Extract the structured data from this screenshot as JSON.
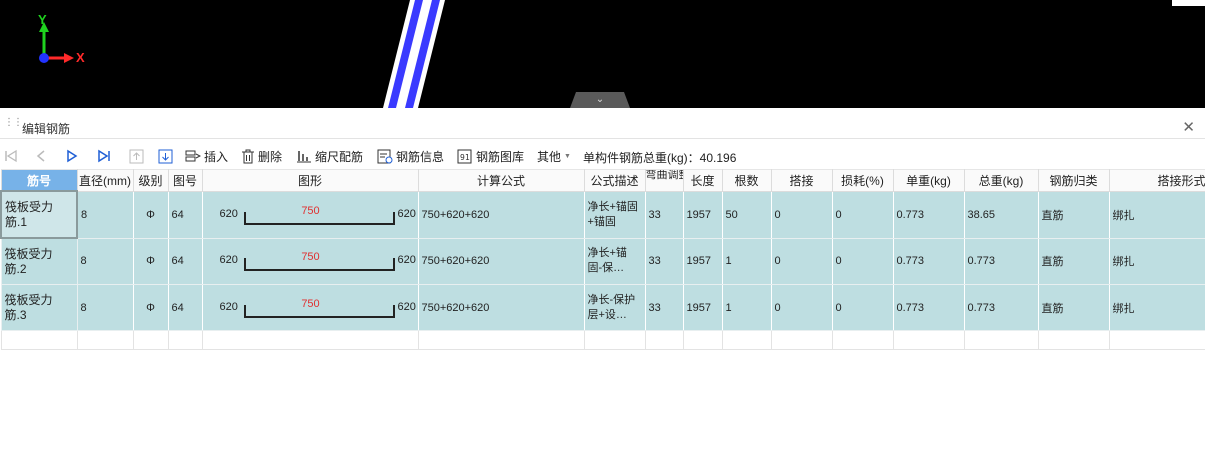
{
  "viewport": {
    "axis_y": "Y",
    "axis_x": "X",
    "colors": {
      "axis_y": "#1fd21f",
      "axis_x": "#ff2a2a",
      "origin": "#2233ff",
      "rebar": "#3a3aff"
    }
  },
  "panel": {
    "title": "编辑钢筋",
    "close_icon": "close-icon"
  },
  "toolbar": {
    "insert": "插入",
    "delete": "删除",
    "scale_rebar": "缩尺配筋",
    "rebar_info": "钢筋信息",
    "rebar_library": "钢筋图库",
    "other": "其他",
    "summary": "单构件钢筋总重(kg)：40.196"
  },
  "table": {
    "headers": [
      "筋号",
      "直径(mm)",
      "级别",
      "图号",
      "图形",
      "计算公式",
      "公式描述",
      "弯曲调整",
      "长度",
      "根数",
      "搭接",
      "损耗(%)",
      "单重(kg)",
      "总重(kg)",
      "钢筋归类",
      "搭接形式"
    ],
    "rows": [
      {
        "name": "筏板受力筋.1",
        "diameter": "8",
        "grade": "Φ",
        "fig": "64",
        "shape": {
          "left": "620",
          "mid": "750",
          "right": "620"
        },
        "formula": "750+620+620",
        "desc": "净长+锚固+锚固",
        "bend": "33",
        "length": "1957",
        "count": "50",
        "lap": "0",
        "loss": "0",
        "unit_weight": "0.773",
        "total_weight": "38.65",
        "category": "直筋",
        "lap_type": "绑扎"
      },
      {
        "name": "筏板受力筋.2",
        "diameter": "8",
        "grade": "Φ",
        "fig": "64",
        "shape": {
          "left": "620",
          "mid": "750",
          "right": "620"
        },
        "formula": "750+620+620",
        "desc": "净长+锚固-保…",
        "bend": "33",
        "length": "1957",
        "count": "1",
        "lap": "0",
        "loss": "0",
        "unit_weight": "0.773",
        "total_weight": "0.773",
        "category": "直筋",
        "lap_type": "绑扎"
      },
      {
        "name": "筏板受力筋.3",
        "diameter": "8",
        "grade": "Φ",
        "fig": "64",
        "shape": {
          "left": "620",
          "mid": "750",
          "right": "620"
        },
        "formula": "750+620+620",
        "desc": "净长-保护层+设…",
        "bend": "33",
        "length": "1957",
        "count": "1",
        "lap": "0",
        "loss": "0",
        "unit_weight": "0.773",
        "total_weight": "0.773",
        "category": "直筋",
        "lap_type": "绑扎"
      }
    ]
  }
}
